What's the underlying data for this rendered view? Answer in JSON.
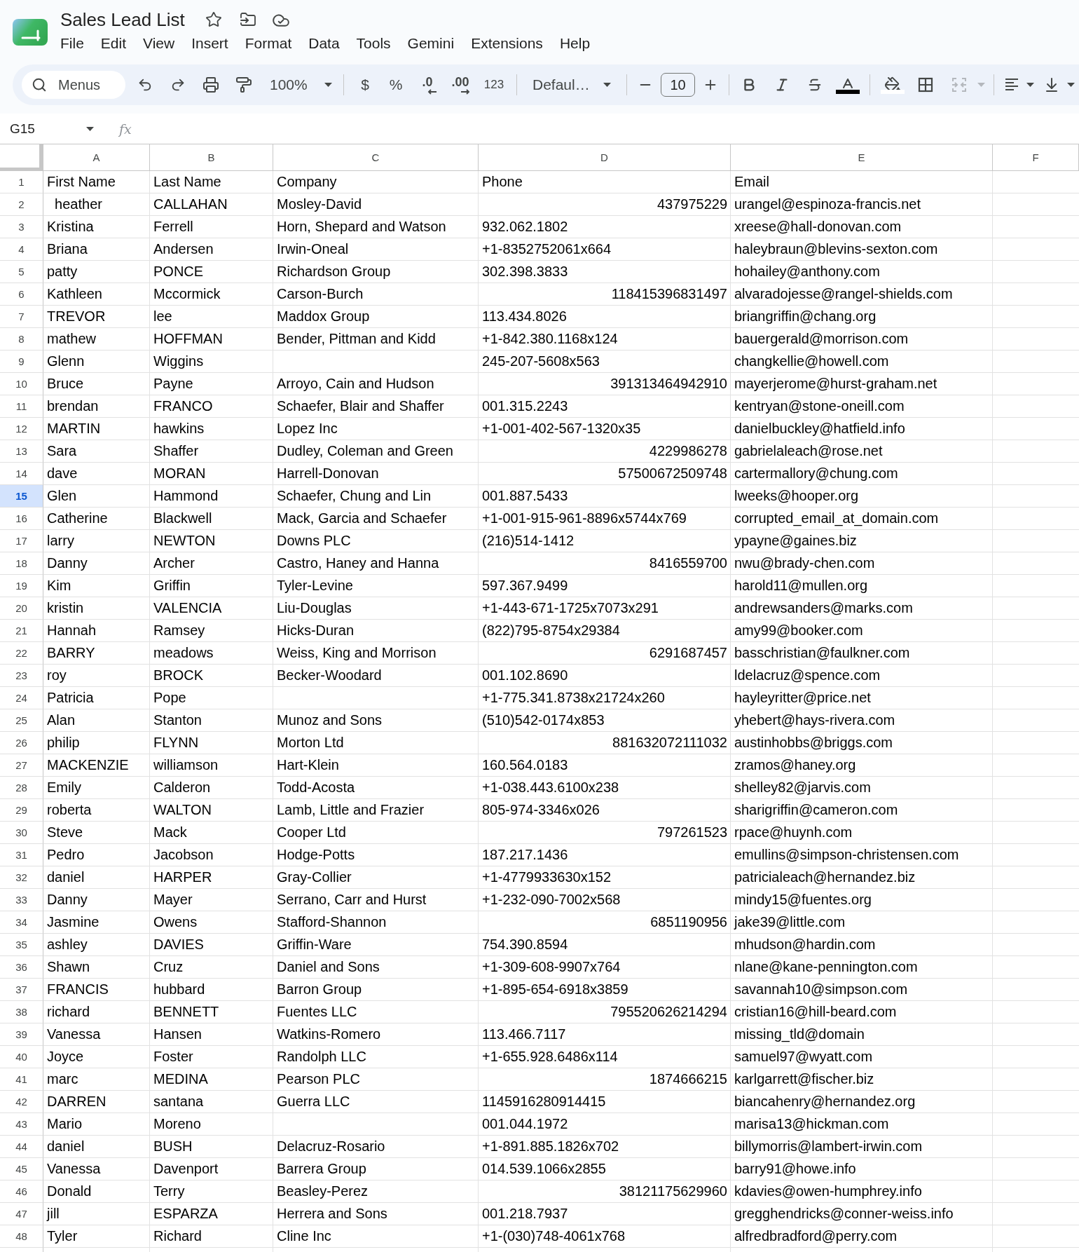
{
  "document": {
    "title": "Sales Lead List"
  },
  "menu": [
    "File",
    "Edit",
    "View",
    "Insert",
    "Format",
    "Data",
    "Tools",
    "Gemini",
    "Extensions",
    "Help"
  ],
  "toolbar": {
    "search": {
      "placeholder": "Menus"
    },
    "zoom": "100%",
    "currency": "$",
    "percent": "%",
    "decrease_decimal": ".0",
    "increase_decimal": ".00",
    "number_formats": "123",
    "font": "Defaul…",
    "font_size": "10",
    "merge_disabled": true
  },
  "formula_bar": {
    "cell_reference": "G15",
    "function_label": "fx"
  },
  "sheet": {
    "columns": [
      {
        "label": "A",
        "selected": false
      },
      {
        "label": "B",
        "selected": false
      },
      {
        "label": "C",
        "selected": false
      },
      {
        "label": "D",
        "selected": false
      },
      {
        "label": "E",
        "selected": false
      },
      {
        "label": "F",
        "selected": false
      }
    ],
    "rows": [
      {
        "number": "1",
        "selected": false,
        "cells": [
          {
            "kind": "text",
            "text": "First Name"
          },
          {
            "kind": "text",
            "text": "Last Name"
          },
          {
            "kind": "text",
            "text": "Company"
          },
          {
            "kind": "text",
            "text": "Phone"
          },
          {
            "kind": "text",
            "text": "Email"
          }
        ]
      },
      {
        "number": "2",
        "selected": false,
        "cells": [
          {
            "kind": "text",
            "text": "  heather"
          },
          {
            "kind": "text",
            "text": "CALLAHAN"
          },
          {
            "kind": "text",
            "text": "Mosley-David"
          },
          {
            "kind": "number",
            "text": "437975229"
          },
          {
            "kind": "text",
            "text": "urangel@espinoza-francis.net"
          }
        ]
      },
      {
        "number": "3",
        "selected": false,
        "cells": [
          {
            "kind": "text",
            "text": "Kristina"
          },
          {
            "kind": "text",
            "text": "Ferrell"
          },
          {
            "kind": "text",
            "text": "Horn, Shepard and Watson"
          },
          {
            "kind": "text",
            "text": "932.062.1802"
          },
          {
            "kind": "text",
            "text": "xreese@hall-donovan.com"
          }
        ]
      },
      {
        "number": "4",
        "selected": false,
        "cells": [
          {
            "kind": "text",
            "text": "Briana"
          },
          {
            "kind": "text",
            "text": "Andersen"
          },
          {
            "kind": "text",
            "text": "Irwin-Oneal"
          },
          {
            "kind": "text",
            "text": "+1-8352752061x664"
          },
          {
            "kind": "text",
            "text": "haleybraun@blevins-sexton.com"
          }
        ]
      },
      {
        "number": "5",
        "selected": false,
        "cells": [
          {
            "kind": "text",
            "text": "patty"
          },
          {
            "kind": "text",
            "text": "PONCE"
          },
          {
            "kind": "text",
            "text": "Richardson Group"
          },
          {
            "kind": "text",
            "text": "302.398.3833"
          },
          {
            "kind": "text",
            "text": "hohailey@anthony.com"
          }
        ]
      },
      {
        "number": "6",
        "selected": false,
        "cells": [
          {
            "kind": "text",
            "text": "Kathleen"
          },
          {
            "kind": "text",
            "text": "Mccormick"
          },
          {
            "kind": "text",
            "text": "Carson-Burch"
          },
          {
            "kind": "number",
            "text": "118415396831497"
          },
          {
            "kind": "text",
            "text": "alvaradojesse@rangel-shields.com"
          }
        ]
      },
      {
        "number": "7",
        "selected": false,
        "cells": [
          {
            "kind": "text",
            "text": "TREVOR"
          },
          {
            "kind": "text",
            "text": "lee"
          },
          {
            "kind": "text",
            "text": "Maddox Group"
          },
          {
            "kind": "text",
            "text": "113.434.8026"
          },
          {
            "kind": "text",
            "text": "briangriffin@chang.org"
          }
        ]
      },
      {
        "number": "8",
        "selected": false,
        "cells": [
          {
            "kind": "text",
            "text": "mathew"
          },
          {
            "kind": "text",
            "text": "HOFFMAN"
          },
          {
            "kind": "text",
            "text": "Bender, Pittman and Kidd"
          },
          {
            "kind": "text",
            "text": "+1-842.380.1168x124"
          },
          {
            "kind": "text",
            "text": "bauergerald@morrison.com"
          }
        ]
      },
      {
        "number": "9",
        "selected": false,
        "cells": [
          {
            "kind": "text",
            "text": "Glenn"
          },
          {
            "kind": "text",
            "text": "Wiggins"
          },
          {
            "kind": "blank"
          },
          {
            "kind": "text",
            "text": "245-207-5608x563"
          },
          {
            "kind": "text",
            "text": "changkellie@howell.com"
          }
        ]
      },
      {
        "number": "10",
        "selected": false,
        "cells": [
          {
            "kind": "text",
            "text": "Bruce"
          },
          {
            "kind": "text",
            "text": "Payne"
          },
          {
            "kind": "text",
            "text": "Arroyo, Cain and Hudson"
          },
          {
            "kind": "number",
            "text": "391313464942910"
          },
          {
            "kind": "text",
            "text": "mayerjerome@hurst-graham.net"
          }
        ]
      },
      {
        "number": "11",
        "selected": false,
        "cells": [
          {
            "kind": "text",
            "text": "brendan"
          },
          {
            "kind": "text",
            "text": "FRANCO"
          },
          {
            "kind": "text",
            "text": "Schaefer, Blair and Shaffer"
          },
          {
            "kind": "text",
            "text": "001.315.2243"
          },
          {
            "kind": "text",
            "text": "kentryan@stone-oneill.com"
          }
        ]
      },
      {
        "number": "12",
        "selected": false,
        "cells": [
          {
            "kind": "text",
            "text": "MARTIN"
          },
          {
            "kind": "text",
            "text": "hawkins"
          },
          {
            "kind": "text",
            "text": "Lopez Inc"
          },
          {
            "kind": "text",
            "text": "+1-001-402-567-1320x35"
          },
          {
            "kind": "text",
            "text": "danielbuckley@hatfield.info"
          }
        ]
      },
      {
        "number": "13",
        "selected": false,
        "cells": [
          {
            "kind": "text",
            "text": "Sara"
          },
          {
            "kind": "text",
            "text": "Shaffer"
          },
          {
            "kind": "text",
            "text": "Dudley, Coleman and Green"
          },
          {
            "kind": "number",
            "text": "4229986278"
          },
          {
            "kind": "text",
            "text": "gabrielaleach@rose.net"
          }
        ]
      },
      {
        "number": "14",
        "selected": false,
        "cells": [
          {
            "kind": "text",
            "text": "dave"
          },
          {
            "kind": "text",
            "text": "MORAN"
          },
          {
            "kind": "text",
            "text": "Harrell-Donovan"
          },
          {
            "kind": "number",
            "text": "57500672509748"
          },
          {
            "kind": "text",
            "text": "cartermallory@chung.com"
          }
        ]
      },
      {
        "number": "15",
        "selected": true,
        "cells": [
          {
            "kind": "text",
            "text": "Glen"
          },
          {
            "kind": "text",
            "text": "Hammond"
          },
          {
            "kind": "text",
            "text": "Schaefer, Chung and Lin"
          },
          {
            "kind": "text",
            "text": "001.887.5433"
          },
          {
            "kind": "text",
            "text": "lweeks@hooper.org"
          }
        ]
      },
      {
        "number": "16",
        "selected": false,
        "cells": [
          {
            "kind": "text",
            "text": "Catherine"
          },
          {
            "kind": "text",
            "text": "Blackwell"
          },
          {
            "kind": "text",
            "text": "Mack, Garcia and Schaefer"
          },
          {
            "kind": "text",
            "text": "+1-001-915-961-8896x5744x769"
          },
          {
            "kind": "text",
            "text": "corrupted_email_at_domain.com"
          }
        ]
      },
      {
        "number": "17",
        "selected": false,
        "cells": [
          {
            "kind": "text",
            "text": "larry"
          },
          {
            "kind": "text",
            "text": "NEWTON"
          },
          {
            "kind": "text",
            "text": "Downs PLC"
          },
          {
            "kind": "text",
            "text": "(216)514-1412"
          },
          {
            "kind": "text",
            "text": "ypayne@gaines.biz"
          }
        ]
      },
      {
        "number": "18",
        "selected": false,
        "cells": [
          {
            "kind": "text",
            "text": "Danny"
          },
          {
            "kind": "text",
            "text": "Archer"
          },
          {
            "kind": "text",
            "text": "Castro, Haney and Hanna"
          },
          {
            "kind": "number",
            "text": "8416559700"
          },
          {
            "kind": "text",
            "text": "nwu@brady-chen.com"
          }
        ]
      },
      {
        "number": "19",
        "selected": false,
        "cells": [
          {
            "kind": "text",
            "text": "Kim"
          },
          {
            "kind": "text",
            "text": "Griffin"
          },
          {
            "kind": "text",
            "text": "Tyler-Levine"
          },
          {
            "kind": "text",
            "text": "597.367.9499"
          },
          {
            "kind": "text",
            "text": "harold11@mullen.org"
          }
        ]
      },
      {
        "number": "20",
        "selected": false,
        "cells": [
          {
            "kind": "text",
            "text": "kristin"
          },
          {
            "kind": "text",
            "text": "VALENCIA"
          },
          {
            "kind": "text",
            "text": "Liu-Douglas"
          },
          {
            "kind": "text",
            "text": "+1-443-671-1725x7073x291"
          },
          {
            "kind": "text",
            "text": "andrewsanders@marks.com"
          }
        ]
      },
      {
        "number": "21",
        "selected": false,
        "cells": [
          {
            "kind": "text",
            "text": "Hannah"
          },
          {
            "kind": "text",
            "text": "Ramsey"
          },
          {
            "kind": "text",
            "text": "Hicks-Duran"
          },
          {
            "kind": "text",
            "text": "(822)795-8754x29384"
          },
          {
            "kind": "text",
            "text": "amy99@booker.com"
          }
        ]
      },
      {
        "number": "22",
        "selected": false,
        "cells": [
          {
            "kind": "text",
            "text": "BARRY"
          },
          {
            "kind": "text",
            "text": "meadows"
          },
          {
            "kind": "text",
            "text": "Weiss, King and Morrison"
          },
          {
            "kind": "number",
            "text": "6291687457"
          },
          {
            "kind": "text",
            "text": "basschristian@faulkner.com"
          }
        ]
      },
      {
        "number": "23",
        "selected": false,
        "cells": [
          {
            "kind": "text",
            "text": "roy"
          },
          {
            "kind": "text",
            "text": "BROCK"
          },
          {
            "kind": "text",
            "text": "Becker-Woodard"
          },
          {
            "kind": "text",
            "text": "001.102.8690"
          },
          {
            "kind": "text",
            "text": "ldelacruz@spence.com"
          }
        ]
      },
      {
        "number": "24",
        "selected": false,
        "cells": [
          {
            "kind": "text",
            "text": "Patricia"
          },
          {
            "kind": "text",
            "text": "Pope"
          },
          {
            "kind": "blank"
          },
          {
            "kind": "text",
            "text": "+1-775.341.8738x21724x260"
          },
          {
            "kind": "text",
            "text": "hayleyritter@price.net"
          }
        ]
      },
      {
        "number": "25",
        "selected": false,
        "cells": [
          {
            "kind": "text",
            "text": "Alan"
          },
          {
            "kind": "text",
            "text": "Stanton"
          },
          {
            "kind": "text",
            "text": "Munoz and Sons"
          },
          {
            "kind": "text",
            "text": "(510)542-0174x853"
          },
          {
            "kind": "text",
            "text": "yhebert@hays-rivera.com"
          }
        ]
      },
      {
        "number": "26",
        "selected": false,
        "cells": [
          {
            "kind": "text",
            "text": "philip"
          },
          {
            "kind": "text",
            "text": "FLYNN"
          },
          {
            "kind": "text",
            "text": "Morton Ltd"
          },
          {
            "kind": "number",
            "text": "881632072111032"
          },
          {
            "kind": "text",
            "text": "austinhobbs@briggs.com"
          }
        ]
      },
      {
        "number": "27",
        "selected": false,
        "cells": [
          {
            "kind": "text",
            "text": "MACKENZIE"
          },
          {
            "kind": "text",
            "text": "williamson"
          },
          {
            "kind": "text",
            "text": "Hart-Klein"
          },
          {
            "kind": "text",
            "text": "160.564.0183"
          },
          {
            "kind": "text",
            "text": "zramos@haney.org"
          }
        ]
      },
      {
        "number": "28",
        "selected": false,
        "cells": [
          {
            "kind": "text",
            "text": "Emily"
          },
          {
            "kind": "text",
            "text": "Calderon"
          },
          {
            "kind": "text",
            "text": "Todd-Acosta"
          },
          {
            "kind": "text",
            "text": "+1-038.443.6100x238"
          },
          {
            "kind": "text",
            "text": "shelley82@jarvis.com"
          }
        ]
      },
      {
        "number": "29",
        "selected": false,
        "cells": [
          {
            "kind": "text",
            "text": "roberta"
          },
          {
            "kind": "text",
            "text": "WALTON"
          },
          {
            "kind": "text",
            "text": "Lamb, Little and Frazier"
          },
          {
            "kind": "text",
            "text": "805-974-3346x026"
          },
          {
            "kind": "text",
            "text": "sharigriffin@cameron.com"
          }
        ]
      },
      {
        "number": "30",
        "selected": false,
        "cells": [
          {
            "kind": "text",
            "text": "Steve"
          },
          {
            "kind": "text",
            "text": "Mack"
          },
          {
            "kind": "text",
            "text": "Cooper Ltd"
          },
          {
            "kind": "number",
            "text": "797261523"
          },
          {
            "kind": "text",
            "text": "rpace@huynh.com"
          }
        ]
      },
      {
        "number": "31",
        "selected": false,
        "cells": [
          {
            "kind": "text",
            "text": "Pedro"
          },
          {
            "kind": "text",
            "text": "Jacobson"
          },
          {
            "kind": "text",
            "text": "Hodge-Potts"
          },
          {
            "kind": "text",
            "text": "187.217.1436"
          },
          {
            "kind": "text",
            "text": "emullins@simpson-christensen.com"
          }
        ]
      },
      {
        "number": "32",
        "selected": false,
        "cells": [
          {
            "kind": "text",
            "text": "daniel"
          },
          {
            "kind": "text",
            "text": "HARPER"
          },
          {
            "kind": "text",
            "text": "Gray-Collier"
          },
          {
            "kind": "text",
            "text": "+1-4779933630x152"
          },
          {
            "kind": "text",
            "text": "patricialeach@hernandez.biz"
          }
        ]
      },
      {
        "number": "33",
        "selected": false,
        "cells": [
          {
            "kind": "text",
            "text": "Danny"
          },
          {
            "kind": "text",
            "text": "Mayer"
          },
          {
            "kind": "text",
            "text": "Serrano, Carr and Hurst"
          },
          {
            "kind": "text",
            "text": "+1-232-090-7002x568"
          },
          {
            "kind": "text",
            "text": "mindy15@fuentes.org"
          }
        ]
      },
      {
        "number": "34",
        "selected": false,
        "cells": [
          {
            "kind": "text",
            "text": "Jasmine"
          },
          {
            "kind": "text",
            "text": "Owens"
          },
          {
            "kind": "text",
            "text": "Stafford-Shannon"
          },
          {
            "kind": "number",
            "text": "6851190956"
          },
          {
            "kind": "text",
            "text": "jake39@little.com"
          }
        ]
      },
      {
        "number": "35",
        "selected": false,
        "cells": [
          {
            "kind": "text",
            "text": "ashley"
          },
          {
            "kind": "text",
            "text": "DAVIES"
          },
          {
            "kind": "text",
            "text": "Griffin-Ware"
          },
          {
            "kind": "text",
            "text": "754.390.8594"
          },
          {
            "kind": "text",
            "text": "mhudson@hardin.com"
          }
        ]
      },
      {
        "number": "36",
        "selected": false,
        "cells": [
          {
            "kind": "text",
            "text": "Shawn"
          },
          {
            "kind": "text",
            "text": "Cruz"
          },
          {
            "kind": "text",
            "text": "Daniel and Sons"
          },
          {
            "kind": "text",
            "text": "+1-309-608-9907x764"
          },
          {
            "kind": "text",
            "text": "nlane@kane-pennington.com"
          }
        ]
      },
      {
        "number": "37",
        "selected": false,
        "cells": [
          {
            "kind": "text",
            "text": "FRANCIS"
          },
          {
            "kind": "text",
            "text": "hubbard"
          },
          {
            "kind": "text",
            "text": "Barron Group"
          },
          {
            "kind": "text",
            "text": "+1-895-654-6918x3859"
          },
          {
            "kind": "text",
            "text": "savannah10@simpson.com"
          }
        ]
      },
      {
        "number": "38",
        "selected": false,
        "cells": [
          {
            "kind": "text",
            "text": "richard"
          },
          {
            "kind": "text",
            "text": "BENNETT"
          },
          {
            "kind": "text",
            "text": "Fuentes LLC"
          },
          {
            "kind": "number",
            "text": "795520626214294"
          },
          {
            "kind": "text",
            "text": "cristian16@hill-beard.com"
          }
        ]
      },
      {
        "number": "39",
        "selected": false,
        "cells": [
          {
            "kind": "text",
            "text": "Vanessa"
          },
          {
            "kind": "text",
            "text": "Hansen"
          },
          {
            "kind": "text",
            "text": "Watkins-Romero"
          },
          {
            "kind": "text",
            "text": "113.466.7117"
          },
          {
            "kind": "text",
            "text": "missing_tld@domain"
          }
        ]
      },
      {
        "number": "40",
        "selected": false,
        "cells": [
          {
            "kind": "text",
            "text": "Joyce"
          },
          {
            "kind": "text",
            "text": "Foster"
          },
          {
            "kind": "text",
            "text": "Randolph LLC"
          },
          {
            "kind": "text",
            "text": "+1-655.928.6486x114"
          },
          {
            "kind": "text",
            "text": "samuel97@wyatt.com"
          }
        ]
      },
      {
        "number": "41",
        "selected": false,
        "cells": [
          {
            "kind": "text",
            "text": "marc"
          },
          {
            "kind": "text",
            "text": "MEDINA"
          },
          {
            "kind": "text",
            "text": "Pearson PLC"
          },
          {
            "kind": "number",
            "text": "1874666215"
          },
          {
            "kind": "text",
            "text": "karlgarrett@fischer.biz"
          }
        ]
      },
      {
        "number": "42",
        "selected": false,
        "cells": [
          {
            "kind": "text",
            "text": "DARREN"
          },
          {
            "kind": "text",
            "text": "santana"
          },
          {
            "kind": "text",
            "text": "Guerra LLC"
          },
          {
            "kind": "text",
            "text": "1145916280914415"
          },
          {
            "kind": "text",
            "text": "biancahenry@hernandez.org"
          }
        ]
      },
      {
        "number": "43",
        "selected": false,
        "cells": [
          {
            "kind": "text",
            "text": "Mario"
          },
          {
            "kind": "text",
            "text": "Moreno"
          },
          {
            "kind": "blank"
          },
          {
            "kind": "text",
            "text": "001.044.1972"
          },
          {
            "kind": "text",
            "text": "marisa13@hickman.com"
          }
        ]
      },
      {
        "number": "44",
        "selected": false,
        "cells": [
          {
            "kind": "text",
            "text": "daniel"
          },
          {
            "kind": "text",
            "text": "BUSH"
          },
          {
            "kind": "text",
            "text": "Delacruz-Rosario"
          },
          {
            "kind": "text",
            "text": "+1-891.885.1826x702"
          },
          {
            "kind": "text",
            "text": "billymorris@lambert-irwin.com"
          }
        ]
      },
      {
        "number": "45",
        "selected": false,
        "cells": [
          {
            "kind": "text",
            "text": "Vanessa"
          },
          {
            "kind": "text",
            "text": "Davenport"
          },
          {
            "kind": "text",
            "text": "Barrera Group"
          },
          {
            "kind": "text",
            "text": "014.539.1066x2855"
          },
          {
            "kind": "text",
            "text": "barry91@howe.info"
          }
        ]
      },
      {
        "number": "46",
        "selected": false,
        "cells": [
          {
            "kind": "text",
            "text": "Donald"
          },
          {
            "kind": "text",
            "text": "Terry"
          },
          {
            "kind": "text",
            "text": "Beasley-Perez"
          },
          {
            "kind": "number",
            "text": "38121175629960"
          },
          {
            "kind": "text",
            "text": "kdavies@owen-humphrey.info"
          }
        ]
      },
      {
        "number": "47",
        "selected": false,
        "cells": [
          {
            "kind": "text",
            "text": "jill"
          },
          {
            "kind": "text",
            "text": "ESPARZA"
          },
          {
            "kind": "text",
            "text": "Herrera and Sons"
          },
          {
            "kind": "text",
            "text": "001.218.7937"
          },
          {
            "kind": "text",
            "text": "gregghendricks@conner-weiss.info"
          }
        ]
      },
      {
        "number": "48",
        "selected": false,
        "cells": [
          {
            "kind": "text",
            "text": "Tyler"
          },
          {
            "kind": "text",
            "text": "Richard"
          },
          {
            "kind": "text",
            "text": "Cline Inc"
          },
          {
            "kind": "text",
            "text": "+1-(030)748-4061x768"
          },
          {
            "kind": "text",
            "text": "alfredbradford@perry.com"
          }
        ]
      }
    ]
  }
}
